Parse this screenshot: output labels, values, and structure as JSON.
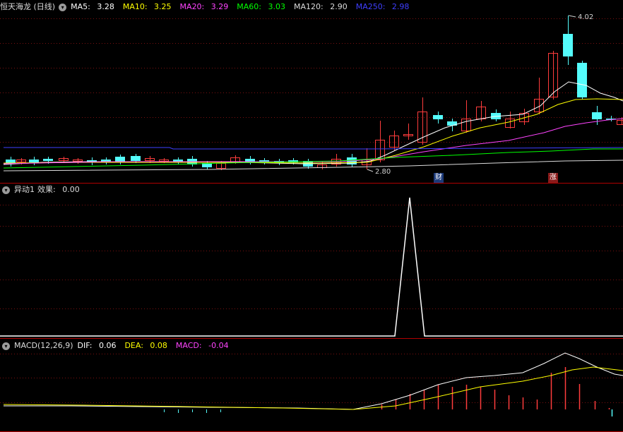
{
  "panel_main": {
    "title": "恒天海龙 (日线)",
    "indicators": [
      {
        "label": "MA5:",
        "value": "3.28",
        "color": "#ffffff"
      },
      {
        "label": "MA10:",
        "value": "3.25",
        "color": "#ffff00"
      },
      {
        "label": "MA20:",
        "value": "3.29",
        "color": "#ff44ff"
      },
      {
        "label": "MA60:",
        "value": "3.03",
        "color": "#00ff00"
      },
      {
        "label": "MA120:",
        "value": "2.90",
        "color": "#dcdcdc"
      },
      {
        "label": "MA250:",
        "value": "2.98",
        "color": "#3f3fff"
      }
    ],
    "high_label": "4.02",
    "low_label": "2.80",
    "badge_cai": "财",
    "badge_zhang": "涨"
  },
  "panel_yidong": {
    "title": "异动1",
    "indicator_label": "效果:",
    "indicator_value": "0.00"
  },
  "panel_macd": {
    "title": "MACD(12,26,9)",
    "dif_label": "DIF:",
    "dif_value": "0.06",
    "dea_label": "DEA:",
    "dea_value": "0.08",
    "macd_label": "MACD:",
    "macd_value": "-0.04"
  },
  "colors": {
    "up": "#ff3c3c",
    "down": "#54fcfc",
    "separator": "#b00000",
    "grid": "#7a1010",
    "ma5": "#ffffff",
    "ma10": "#ffff00",
    "ma20": "#ff44ff",
    "ma60": "#00ff00",
    "ma120": "#dcdcdc",
    "ma250": "#3f3fff"
  }
}
